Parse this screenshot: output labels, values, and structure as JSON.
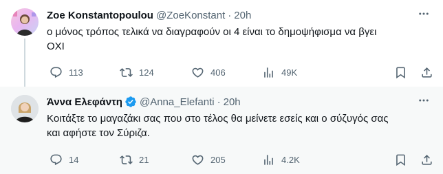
{
  "tweets": [
    {
      "name": "Zoe Konstantopoulou",
      "handle": "@ZoeKonstant",
      "dot": "·",
      "time": "20h",
      "text_lines": [
        "ο μόνος τρόπος τελικά να διαγραφούν οι 4 είναι το δημοψήφισμα να βγει",
        "ΟΧΙ"
      ],
      "replies": "113",
      "retweets": "124",
      "likes": "406",
      "views": "49K"
    },
    {
      "name": "Άννα Ελεφάντη",
      "verified": true,
      "handle": "@Anna_Elefanti",
      "dot": "·",
      "time": "20h",
      "text_lines": [
        "Κοιτάξτε το μαγαζάκι σας που στο τέλος θα μείνετε εσείς και ο σύζυγός σας",
        "και αφήστε τον Σύριζα."
      ],
      "replies": "14",
      "retweets": "21",
      "likes": "205",
      "views": "4.2K"
    }
  ],
  "colors": {
    "text": "#0f1419",
    "secondary": "#536471",
    "verified": "#1d9bf0",
    "thread_line": "#cfd9de",
    "highlight_bg": "#f7f9f9"
  }
}
